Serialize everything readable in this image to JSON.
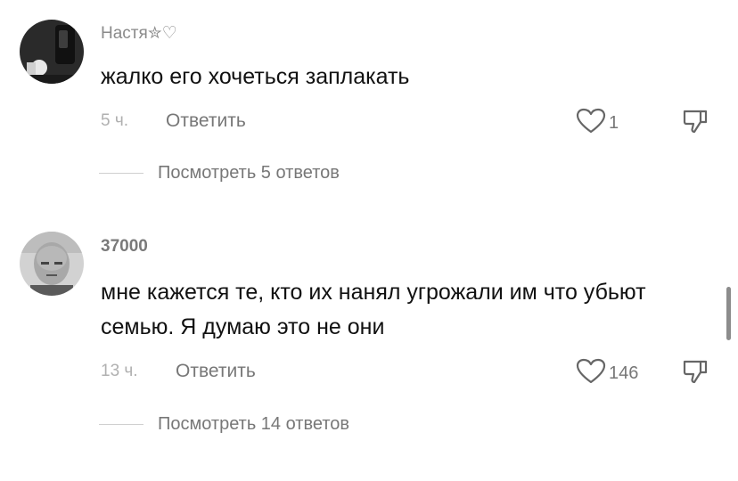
{
  "comments": [
    {
      "username": "Настя",
      "username_suffix": "✮♡",
      "text": "жалко его хочеться заплакать",
      "time": "5 ч.",
      "reply_label": "Ответить",
      "likes": "1",
      "view_replies": "Посмотреть 5 ответов"
    },
    {
      "username": "37000",
      "username_suffix": "",
      "text": "мне кажется те, кто их нанял угрожали им что убьют семью. Я думаю это не они",
      "time": "13 ч.",
      "reply_label": "Ответить",
      "likes": "146",
      "view_replies": "Посмотреть 14 ответов"
    }
  ],
  "colors": {
    "text": "#111111",
    "secondary": "#777777",
    "muted": "#b0b0b0",
    "icon_stroke": "#666666"
  },
  "icons": {
    "like": "heart-outline-icon",
    "dislike": "thumbs-down-outline-icon"
  }
}
